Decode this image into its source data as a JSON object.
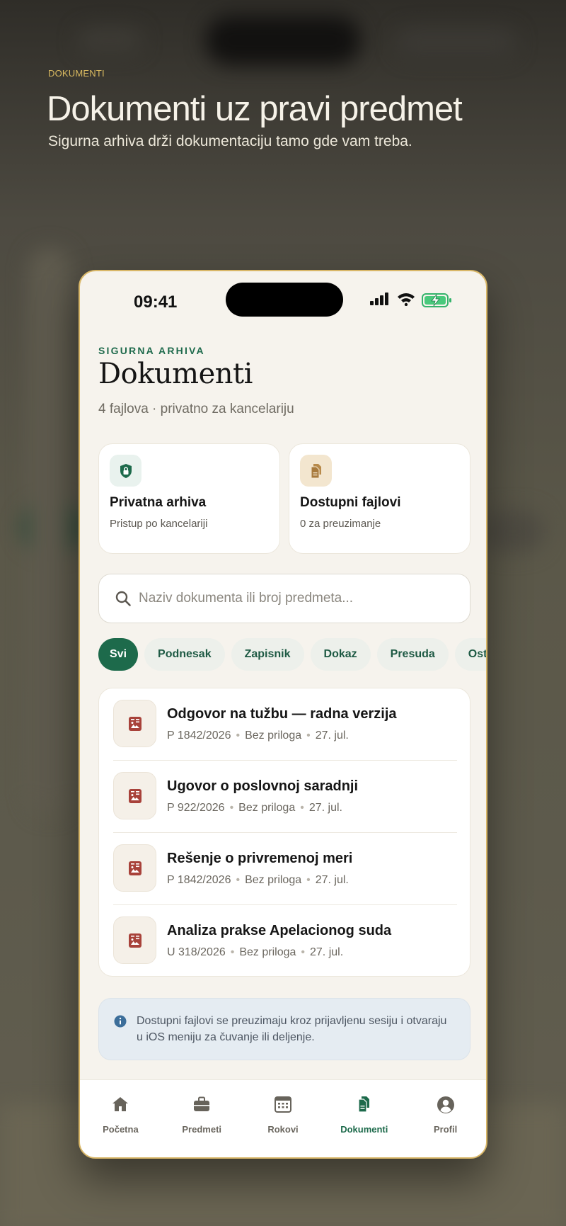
{
  "promo": {
    "eyebrow": "DOKUMENTI",
    "title": "Dokumenti uz pravi predmet",
    "subtitle": "Sigurna arhiva drži dokumentaciju tamo gde vam treba."
  },
  "status_bar": {
    "time": "09:41",
    "icons": [
      "signal-icon",
      "wifi-icon",
      "battery-charging-icon"
    ]
  },
  "header": {
    "kicker": "SIGURNA ARHIVA",
    "title": "Dokumenti",
    "meta": "4 fajlova · privatno za kancelariju"
  },
  "cards": [
    {
      "icon": "lock-shield-icon",
      "title": "Privatna arhiva",
      "subtitle": "Pristup po kancelariji"
    },
    {
      "icon": "files-icon",
      "title": "Dostupni fajlovi",
      "subtitle": "0 za preuzimanje"
    }
  ],
  "search": {
    "placeholder": "Naziv dokumenta ili broj predmeta..."
  },
  "filters": {
    "selected": "Svi",
    "items": [
      "Svi",
      "Podnesak",
      "Zapisnik",
      "Dokaz",
      "Presuda",
      "Ostalo"
    ]
  },
  "documents": [
    {
      "title": "Odgovor na tužbu — radna verzija",
      "case": "P 1842/2026",
      "attachment": "Bez priloga",
      "date": "27. jul."
    },
    {
      "title": "Ugovor o poslovnoj saradnji",
      "case": "P 922/2026",
      "attachment": "Bez priloga",
      "date": "27. jul."
    },
    {
      "title": "Rešenje o privremenoj meri",
      "case": "P 1842/2026",
      "attachment": "Bez priloga",
      "date": "27. jul."
    },
    {
      "title": "Analiza prakse Apelacionog suda",
      "case": "U 318/2026",
      "attachment": "Bez priloga",
      "date": "27. jul."
    }
  ],
  "info": {
    "text": "Dostupni fajlovi se preuzimaju kroz prijavljenu sesiju i otvaraju u iOS meniju za čuvanje ili deljenje."
  },
  "tabs": [
    {
      "label": "Početna",
      "icon": "home-icon",
      "active": false
    },
    {
      "label": "Predmeti",
      "icon": "briefcase-icon",
      "active": false
    },
    {
      "label": "Rokovi",
      "icon": "calendar-icon",
      "active": false
    },
    {
      "label": "Dokumenti",
      "icon": "documents-icon",
      "active": true
    },
    {
      "label": "Profil",
      "icon": "profile-icon",
      "active": false
    }
  ],
  "colors": {
    "accent": "#1d6a4b",
    "gold": "#d9b768",
    "doc_icon": "#a8423a"
  }
}
